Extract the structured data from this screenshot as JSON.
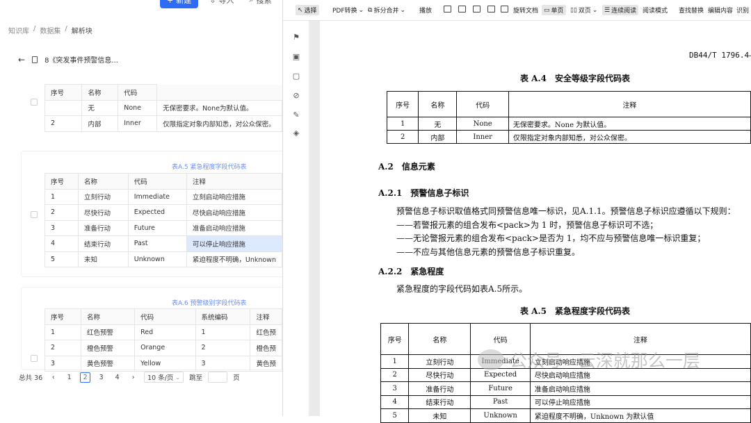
{
  "left": {
    "top_buttons": [
      "新建",
      "导入",
      "搜索"
    ],
    "breadcrumb": [
      "知识库",
      "数据集",
      "解析块"
    ],
    "doc_title": "8《突发事件预警信息...",
    "table1": {
      "header": [
        "序号",
        "名称",
        "代码"
      ],
      "rows": [
        [
          "",
          "无",
          "None",
          "无保密要求。None为默认值。"
        ],
        [
          "2",
          "内部",
          "Inner",
          "仅限指定对象内部知悉，对公众保密。"
        ]
      ]
    },
    "table2": {
      "caption": "表A.5 紧急程度字段代码表",
      "header": [
        "序号",
        "名称",
        "代码",
        "注释"
      ],
      "rows": [
        [
          "1",
          "立刻行动",
          "Immediate",
          "立刻启动响应措施"
        ],
        [
          "2",
          "尽快行动",
          "Expected",
          "尽快启动响应措施"
        ],
        [
          "3",
          "准备行动",
          "Future",
          "准备启动响应措施"
        ],
        [
          "4",
          "结束行动",
          "Past",
          "可以停止响应措施"
        ],
        [
          "5",
          "未知",
          "Unknown",
          "紧迫程度不明确，Unknown"
        ]
      ]
    },
    "table3": {
      "caption": "表A.6 预警级别字段代码表",
      "header": [
        "序号",
        "名称",
        "代码",
        "系统编码",
        "注释"
      ],
      "rows": [
        [
          "1",
          "红色预警",
          "Red",
          "1",
          "红色预"
        ],
        [
          "2",
          "橙色预警",
          "Orange",
          "2",
          "橙色预"
        ],
        [
          "3",
          "黄色预警",
          "Yellow",
          "3",
          "黄色预"
        ]
      ]
    },
    "pager": {
      "total": "总共 36",
      "pages": [
        "1",
        "2",
        "3",
        "4"
      ],
      "current": "2",
      "page_size": "10 条/页",
      "jump_label": "跳至",
      "page_unit": "页"
    }
  },
  "viewer": {
    "toolbar": [
      "选择",
      "PDF转换",
      "拆分合并",
      "播放",
      "旋转文档",
      "单页",
      "双页",
      "连续阅读",
      "阅读模式",
      "查找替换",
      "编辑内容",
      "识别"
    ],
    "sidebar_icons": [
      "bookmark-icon",
      "thumbnail-icon",
      "comment-icon",
      "attachment-icon",
      "signature-icon",
      "layers-icon"
    ]
  },
  "page": {
    "header": "DB44/T 1796.4—",
    "tableA4": {
      "caption": "表 A.4　安全等级字段代码表",
      "header": [
        "序号",
        "名称",
        "代码",
        "注释"
      ],
      "rows": [
        [
          "1",
          "无",
          "None",
          "无保密要求。None 为默认值。"
        ],
        [
          "2",
          "内部",
          "Inner",
          "仅限指定对象内部知悉，对公众保密。"
        ]
      ]
    },
    "a2_title": "A.2　信息元素",
    "a21_title": "A.2.1　预警信息子标识",
    "a21_lines": [
      "预警信息子标识取值格式同预警信息唯一标识，见A.1.1。预警信息子标识应遵循以下规则：",
      "——若警报元素的组合发布<pack>为 1 时，预警信息子标识可不选；",
      "——无论警报元素的组合发布<pack>是否为 1，均不应与预警信息唯一标识重复；",
      "——不应与其他信息元素的预警信息子标识重复。"
    ],
    "a22_title": "A.2.2　紧急程度",
    "a22_line": "紧急程度的字段代码如表A.5所示。",
    "tableA5": {
      "caption": "表 A.5　紧急程度字段代码表",
      "header": [
        "序号",
        "名称",
        "代码",
        "注释"
      ],
      "rows": [
        [
          "1",
          "立刻行动",
          "Immediate",
          "立刻启动响应措施"
        ],
        [
          "2",
          "尽快行动",
          "Expected",
          "尽快启动响应措施"
        ],
        [
          "3",
          "准备行动",
          "Future",
          "准备启动响应措施"
        ],
        [
          "4",
          "结束行动",
          "Past",
          "可以停止响应措施"
        ],
        [
          "5",
          "未知",
          "Unknown",
          "紧迫程度不明确，Unknown 为默认值"
        ]
      ]
    },
    "watermark": "公众号 · 云深就那么一层"
  }
}
